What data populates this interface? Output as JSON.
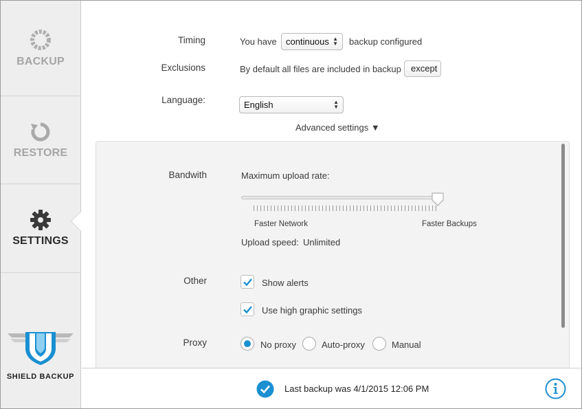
{
  "sidebar": {
    "backup": {
      "label": "BACKUP",
      "icon": "backup-ring-icon"
    },
    "restore": {
      "label": "RESTORE",
      "icon": "restore-arrow-icon"
    },
    "settings": {
      "label": "SETTINGS",
      "icon": "gear-icon",
      "active": true
    },
    "brand": {
      "name": "SHIELD BACKUP",
      "icon": "shield-logo-icon"
    }
  },
  "settings": {
    "timing": {
      "label": "Timing",
      "prefix": "You have",
      "value": "continuous",
      "suffix": "backup configured"
    },
    "exclusions": {
      "label": "Exclusions",
      "text": "By default all files are included in backup",
      "button": "except"
    },
    "language": {
      "label": "Language:",
      "value": "English"
    },
    "advanced_toggle": "Advanced settings ▼"
  },
  "advanced": {
    "bandwidth": {
      "label": "Bandwith",
      "title": "Maximum upload rate:",
      "slider_level": 1.0,
      "min_label": "Faster Network",
      "max_label": "Faster Backups",
      "speed_label": "Upload speed:",
      "speed_value": "Unlimited"
    },
    "other": {
      "label": "Other",
      "options": [
        {
          "label": "Show alerts",
          "checked": true
        },
        {
          "label": "Use high graphic settings",
          "checked": true
        }
      ]
    },
    "proxy": {
      "label": "Proxy",
      "options": [
        {
          "label": "No proxy",
          "selected": true
        },
        {
          "label": "Auto-proxy",
          "selected": false
        },
        {
          "label": "Manual",
          "selected": false
        }
      ]
    }
  },
  "status": {
    "text": "Last backup was 4/1/2015 12:06 PM",
    "icon": "check-circle-icon",
    "info_icon": "info-icon"
  },
  "colors": {
    "accent": "#1a8fd1",
    "sidebar_bg": "#eeeeee",
    "inactive_nav": "#a5a5a5",
    "active_nav": "#2b2b2b"
  }
}
